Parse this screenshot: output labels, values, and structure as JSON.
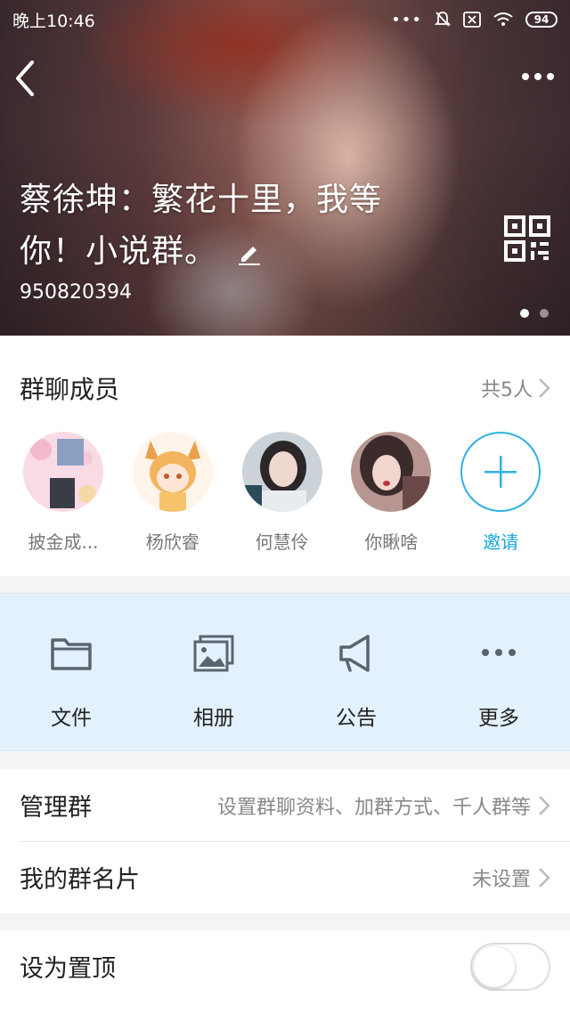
{
  "status_bar": {
    "time": "晚上10:46",
    "dots": "•••",
    "battery": "94"
  },
  "header": {
    "title_line1": "蔡徐坤：繁花十里，我等",
    "title_line2": "你！小说群。",
    "group_id": "950820394"
  },
  "members": {
    "title": "群聊成员",
    "count": "共5人",
    "list": [
      {
        "name": "披金成...",
        "avatar_colors": [
          "#f7d2de",
          "#5b6b86"
        ]
      },
      {
        "name": "杨欣睿",
        "avatar_colors": [
          "#fbe7d6",
          "#e7a24c"
        ]
      },
      {
        "name": "何慧伶",
        "avatar_colors": [
          "#cfd8df",
          "#2a2a2a"
        ]
      },
      {
        "name": "你瞅啥",
        "avatar_colors": [
          "#d7b7b3",
          "#3b2b2a"
        ]
      }
    ],
    "invite_label": "邀请"
  },
  "actions": [
    {
      "label": "文件",
      "icon": "folder-icon"
    },
    {
      "label": "相册",
      "icon": "album-icon"
    },
    {
      "label": "公告",
      "icon": "megaphone-icon"
    },
    {
      "label": "更多",
      "icon": "more-horizontal-icon"
    }
  ],
  "settings": {
    "manage": {
      "title": "管理群",
      "value": "设置群聊资料、加群方式、千人群等"
    },
    "card": {
      "title": "我的群名片",
      "value": "未设置"
    },
    "pin": {
      "title": "设为置顶",
      "on": false
    }
  },
  "colors": {
    "accent": "#19a6dd",
    "actions_bg": "#e3f1fc",
    "icon_gray": "#5a6470"
  }
}
